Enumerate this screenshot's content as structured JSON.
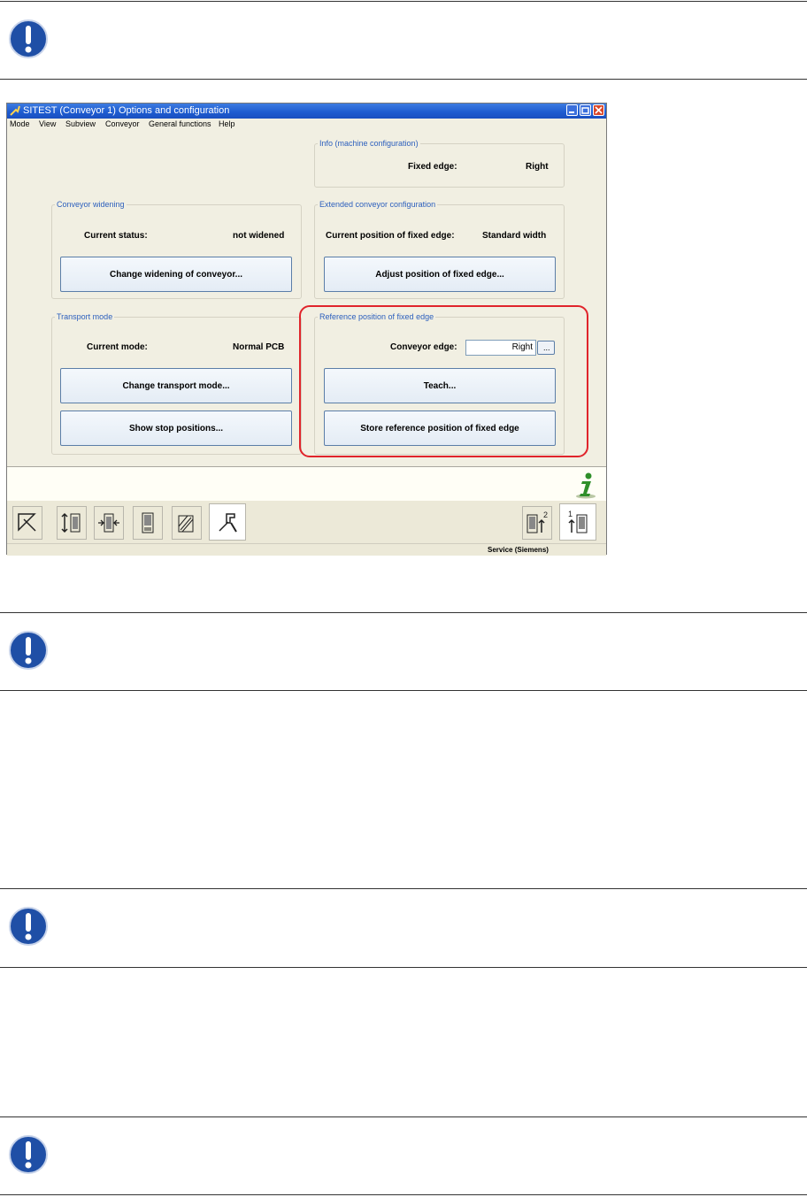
{
  "window": {
    "title": "SITEST  (Conveyor 1) Options and configuration",
    "menu": [
      "Mode",
      "View",
      "Subview",
      "Conveyor",
      "General functions",
      "Help"
    ]
  },
  "info_group": {
    "legend": "Info (machine configuration)",
    "fixed_edge_label": "Fixed edge:",
    "fixed_edge_value": "Right"
  },
  "widening_group": {
    "legend": "Conveyor widening",
    "status_label": "Current status:",
    "status_value": "not widened",
    "button": "Change widening of conveyor..."
  },
  "extended_group": {
    "legend": "Extended conveyor configuration",
    "position_label": "Current position of fixed edge:",
    "position_value": "Standard width",
    "button": "Adjust position of fixed edge..."
  },
  "transport_group": {
    "legend": "Transport mode",
    "mode_label": "Current mode:",
    "mode_value": "Normal PCB",
    "change_button": "Change transport mode...",
    "stop_button": "Show stop positions..."
  },
  "reference_group": {
    "legend": "Reference position of fixed edge",
    "edge_label": "Conveyor edge:",
    "edge_value": "Right",
    "browse_button": "...",
    "teach_button": "Teach...",
    "store_button": "Store reference position of fixed edge"
  },
  "footer": {
    "user": "Service (Siemens)"
  },
  "toolbar": {
    "left_icons": [
      "select-arrow-icon",
      "conveyor-width-icon",
      "conveyor-narrow-icon",
      "conveyor-grid-icon",
      "conveyor-layers-icon",
      "wrench-settings-icon"
    ],
    "right_icons": [
      "conveyor-2-icon",
      "conveyor-1-icon"
    ]
  },
  "colors": {
    "highlight": "#e0242b",
    "note_icon": "#1f4fa6",
    "legend_text": "#2c5fbd"
  }
}
